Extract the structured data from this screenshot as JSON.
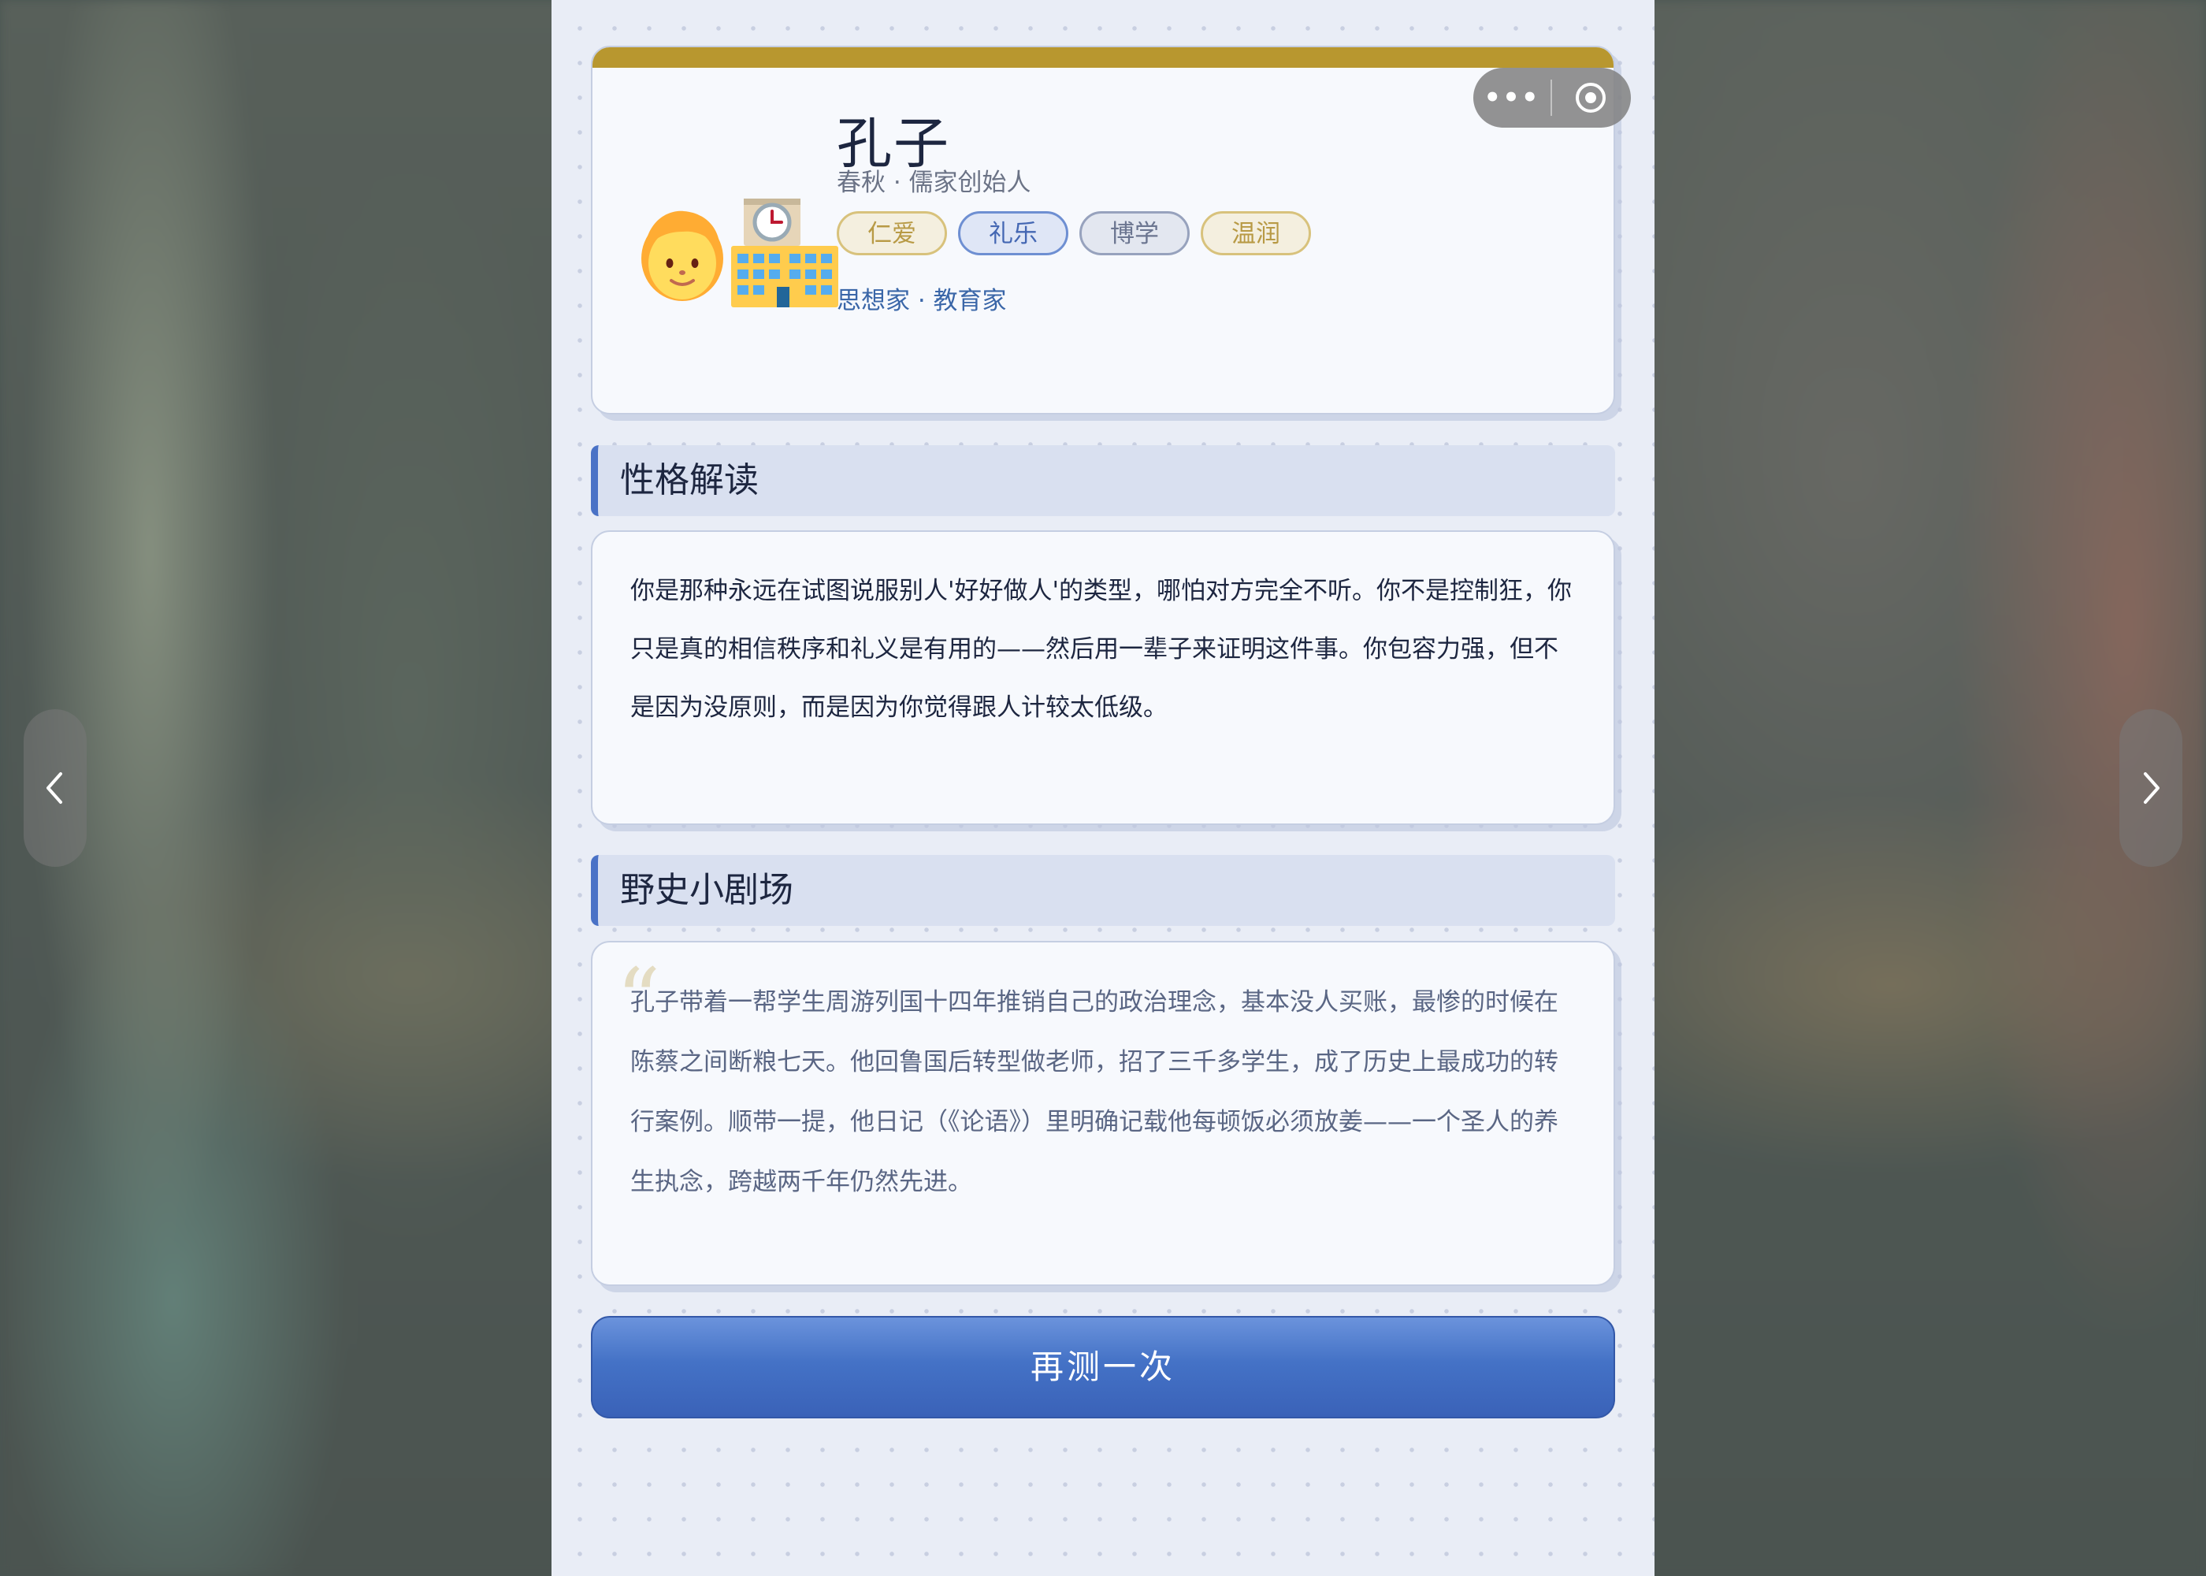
{
  "profile": {
    "name": "孔子",
    "era": "春秋 · 儒家创始人",
    "tags": [
      "仁爱",
      "礼乐",
      "博学",
      "温润"
    ],
    "roles": "思想家 · 教育家",
    "avatar_icons": [
      "person-icon",
      "school-building-icon"
    ]
  },
  "personality": {
    "title": "性格解读",
    "text": "你是那种永远在试图说服别人'好好做人'的类型，哪怕对方完全不听。你不是控制狂，你只是真的相信秩序和礼义是有用的——然后用一辈子来证明这件事。你包容力强，但不是因为没原则，而是因为你觉得跟人计较太低级。"
  },
  "anecdote": {
    "title": "野史小剧场",
    "quote_mark": "“",
    "text": "孔子带着一帮学生周游列国十四年推销自己的政治理念，基本没人买账，最惨的时候在陈蔡之间断粮七天。他回鲁国后转型做老师，招了三千多学生，成了历史上最成功的转行案例。顺带一提，他日记（《论语》）里明确记载他每顿饭必须放姜——一个圣人的养生执念，跨越两千年仍然先进。"
  },
  "actions": {
    "retry_label": "再测一次"
  },
  "capsule": {
    "more_icon": "more-dots-icon",
    "close_icon": "target-circle-icon"
  },
  "nav": {
    "prev_icon": "chevron-left-icon",
    "next_icon": "chevron-right-icon"
  },
  "colors": {
    "accent": "#4a72c6",
    "gold": "#b8972f",
    "page_bg": "#e9edf6"
  }
}
